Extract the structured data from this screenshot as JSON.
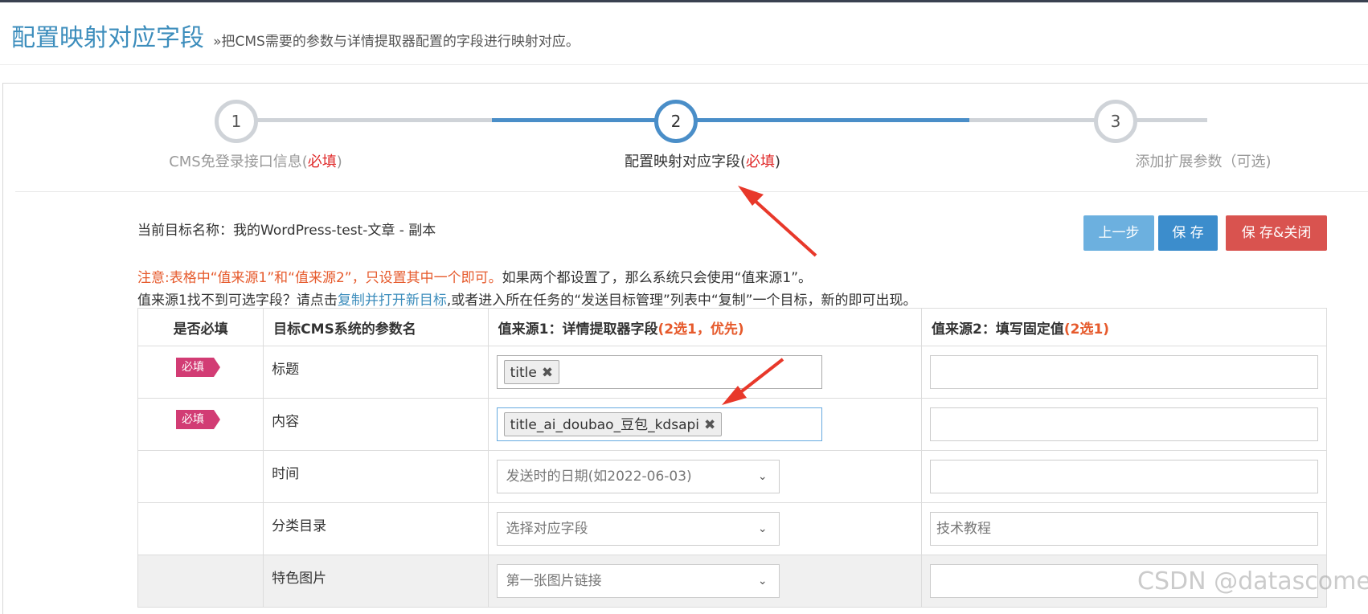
{
  "header": {
    "title": "配置映射对应字段",
    "subtitle": "»把CMS需要的参数与详情提取器配置的字段进行映射对应。"
  },
  "steps": [
    {
      "num": "1",
      "label": "CMS免登录接口信息(",
      "req": "必填",
      "tail": ")"
    },
    {
      "num": "2",
      "label": "配置映射对应字段(",
      "req": "必填",
      "tail": ")"
    },
    {
      "num": "3",
      "label": "添加扩展参数（可选)"
    }
  ],
  "target": {
    "text": "当前目标名称：我的WordPress-test-文章 - 副本"
  },
  "buttons": {
    "prev": "上一步",
    "save": "保 存",
    "save_close": "保 存&关闭"
  },
  "notice": {
    "line1_warn": "注意:表格中“值来源1”和“值来源2”，只设置其中一个即可。",
    "line1_rest": "如果两个都设置了，那么系统只会使用“值来源1”。",
    "line2_a": "值来源1找不到可选字段？请点击",
    "line2_link": "复制并打开新目标",
    "line2_b": ",或者进入所在任务的“发送目标管理”列表中“复制”一个目标，新的即可出现。"
  },
  "table": {
    "headers": {
      "required": "是否必填",
      "param": "目标CMS系统的参数名",
      "source1": "值来源1：详情提取器字段",
      "source1_hl": "(2选1，优先)",
      "source2": "值来源2：填写固定值",
      "source2_hl": "(2选1)"
    },
    "badge": "必填",
    "rows": [
      {
        "param": "标题",
        "tag": "title"
      },
      {
        "param": "内容",
        "tag": "title_ai_doubao_豆包_kdsapi"
      },
      {
        "param": "时间",
        "select": "发送时的日期(如2022-06-03)",
        "fixed": ""
      },
      {
        "param": "分类目录",
        "select": "选择对应字段",
        "fixed": "技术教程"
      },
      {
        "param": "特色图片",
        "select": "第一张图片链接",
        "fixed": ""
      }
    ]
  },
  "watermark": "CSDN @datascome",
  "colors": {
    "accent": "#4a8ec8",
    "danger": "#d9534f",
    "badge": "#d23c74",
    "warn": "#e65a2c"
  }
}
